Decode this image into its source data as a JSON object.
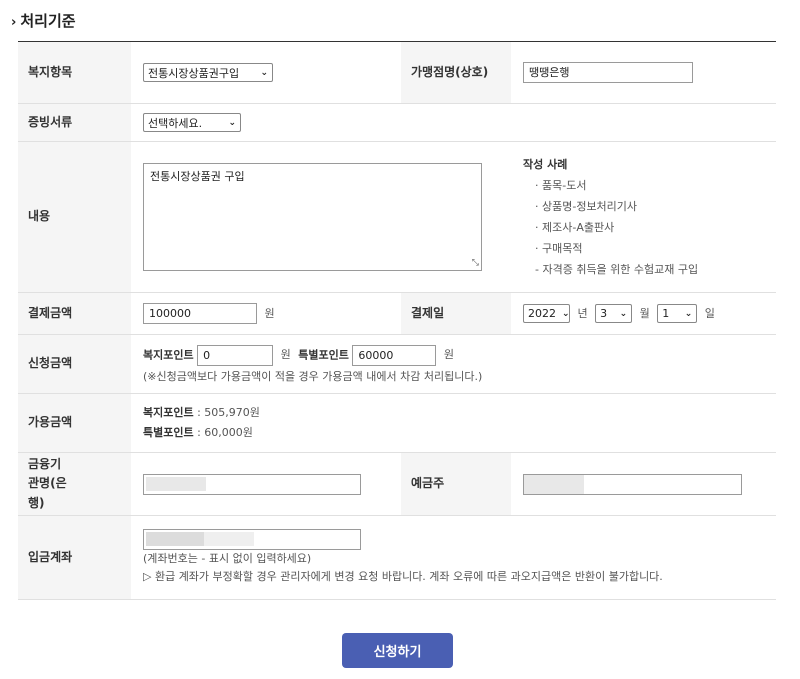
{
  "section": {
    "arrow": "›",
    "title": "처리기준"
  },
  "rows": {
    "welfare_item": {
      "label": "복지항목",
      "value": "전통시장상품권구입",
      "store_label": "가맹점명(상호)",
      "store_value": "땡땡은행"
    },
    "evidence": {
      "label": "증빙서류",
      "value": "선택하세요."
    },
    "content": {
      "label": "내용",
      "value": "전통시장상품권 구입",
      "example_title": "작성 사례",
      "examples": [
        "· 품목-도서",
        "· 상품명-정보처리기사",
        "· 제조사-A출판사",
        "· 구매목적",
        "- 자격증 취득을 위한 수험교재 구입"
      ]
    },
    "payment": {
      "label": "결제금액",
      "value": "100000",
      "unit": "원",
      "date_label": "결제일",
      "year": "2022",
      "year_unit": "년",
      "month": "3",
      "month_unit": "월",
      "day": "1",
      "day_unit": "일"
    },
    "apply": {
      "label": "신청금액",
      "welfare_point_label": "복지포인트",
      "welfare_point_value": "0",
      "unit1": "원",
      "special_point_label": "특별포인트",
      "special_point_value": "60000",
      "unit2": "원",
      "note": "(※신청금액보다 가용금액이 적을 경우 가용금액 내에서 차감 처리됩니다.)"
    },
    "available": {
      "label": "가용금액",
      "welfare_label": "복지포인트",
      "welfare_value": " : 505,970원",
      "special_label": "특별포인트",
      "special_value": " : 60,000원"
    },
    "bank": {
      "label": "금융기관명(은행)",
      "holder_label": "예금주"
    },
    "account": {
      "label": "입금계좌",
      "note1": "(계좌번호는 - 표시 없이 입력하세요)",
      "note2": "▷ 환급 계좌가 부정확할 경우 관리자에게 변경 요청 바랍니다. 계좌 오류에 따른 과오지급액은 반환이 불가합니다."
    }
  },
  "submit": {
    "label": "신청하기"
  },
  "icons": {
    "chevron": "chevron-down-icon",
    "resize": "resize-handle-icon",
    "section_arrow": "chevron-right-icon"
  },
  "colors": {
    "submit_bg": "#4a5fb3",
    "header_bg": "#f5f5f5"
  }
}
